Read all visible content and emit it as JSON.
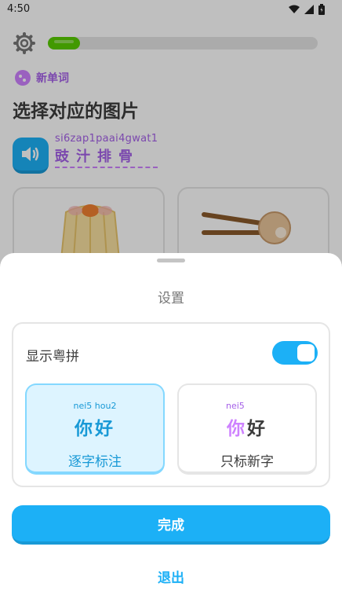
{
  "status_bar": {
    "time": "4:50",
    "icons": [
      "wifi-icon",
      "signal-icon",
      "battery-icon"
    ]
  },
  "lesson": {
    "progress_fraction": 0.12,
    "badge_text": "新单词",
    "title": "选择对应的图片",
    "prompt_jyutping": "si6zap1paai4gwat1",
    "prompt_chars": "豉汁排骨",
    "cards": [
      {
        "image": "steamed-dumpling-image"
      },
      {
        "image": "chopsticks-dumpling-image"
      }
    ]
  },
  "settings_sheet": {
    "title": "设置",
    "toggle_label": "显示粤拼",
    "toggle_on": true,
    "options": [
      {
        "jyutping": "nei5 hou2",
        "chars": "你好",
        "caption": "逐字标注",
        "selected": true
      },
      {
        "jyutping": "nei5",
        "new_char": "你",
        "known_char": "好",
        "caption": "只标新字",
        "selected": false
      }
    ],
    "done_label": "完成",
    "quit_label": "退出"
  },
  "colors": {
    "accent_blue": "#1cb0f6",
    "green": "#58cc02",
    "purple": "#ce82ff"
  }
}
